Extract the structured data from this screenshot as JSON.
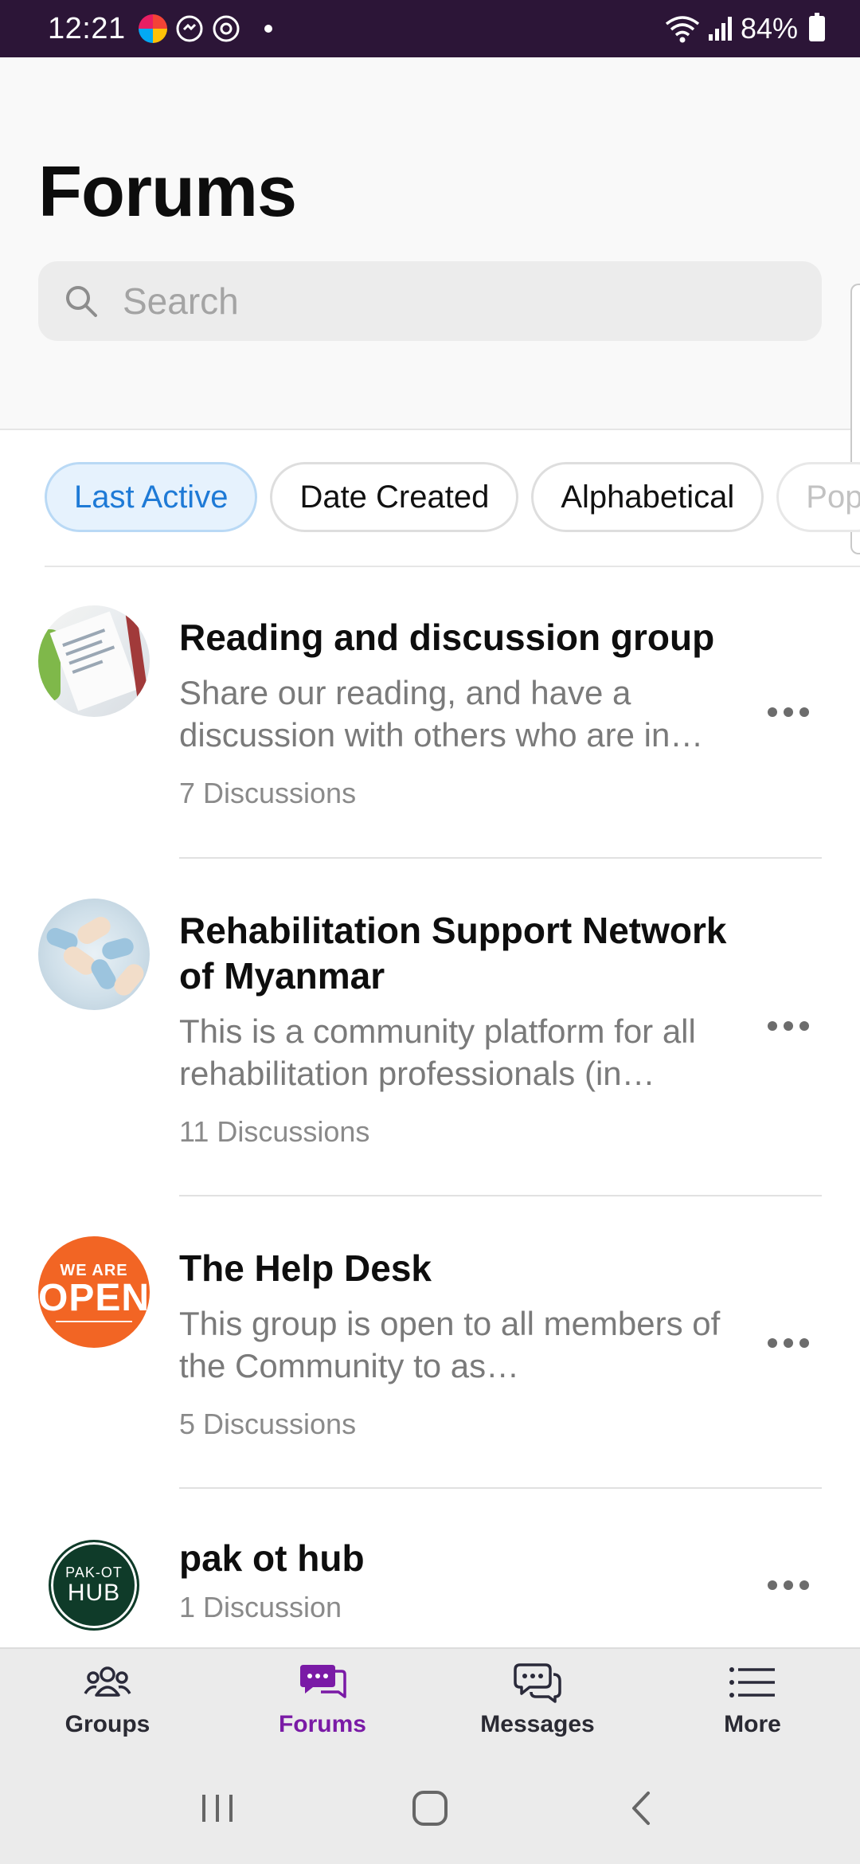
{
  "status_bar": {
    "time": "12:21",
    "battery": "84%",
    "icons": [
      "app-color-icon",
      "app-messenger-icon",
      "app-sync-icon",
      "notification-dot",
      "wifi-icon",
      "signal-icon",
      "battery-icon"
    ]
  },
  "header": {
    "title": "Forums",
    "search_placeholder": "Search"
  },
  "filters": [
    {
      "label": "Last Active",
      "active": true
    },
    {
      "label": "Date Created",
      "active": false
    },
    {
      "label": "Alphabetical",
      "active": false
    },
    {
      "label": "Pop",
      "active": false
    }
  ],
  "forums": [
    {
      "title": "Reading and discussion group",
      "description": "Share our reading, and have a discussion with others who are in…",
      "count": "7 Discussions",
      "avatar": "documents-photo"
    },
    {
      "title": "Rehabilitation Support Network of Myanmar",
      "description": "This is a community platform for all rehabilitation professionals (in…",
      "count": "11 Discussions",
      "avatar": "stacked-hands-photo"
    },
    {
      "title": "The Help Desk",
      "description": "This group is open to all members of the Community to as…",
      "count": "5 Discussions",
      "avatar": {
        "small": "WE ARE",
        "big": "OPEN"
      }
    },
    {
      "title": "pak ot hub",
      "description": "",
      "count": "1 Discussion",
      "avatar": {
        "line1": "PAK-OT",
        "line2": "HUB"
      }
    }
  ],
  "bottom_nav": [
    {
      "label": "Groups",
      "icon": "groups-icon",
      "active": false
    },
    {
      "label": "Forums",
      "icon": "forums-icon",
      "active": true
    },
    {
      "label": "Messages",
      "icon": "messages-icon",
      "active": false
    },
    {
      "label": "More",
      "icon": "menu-icon",
      "active": false
    }
  ],
  "colors": {
    "status_bar": "#2c1537",
    "accent": "#7a1aa6",
    "chip_active_text": "#1e7ad6",
    "chip_active_bg": "#e6f2fd",
    "help_desk_orange": "#f26524",
    "hub_green": "#0f3b29"
  }
}
